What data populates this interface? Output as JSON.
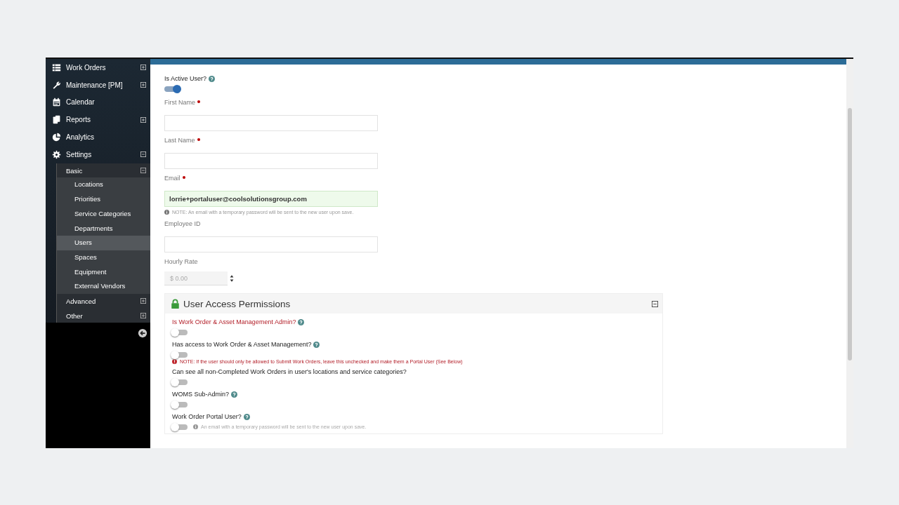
{
  "sidebar": {
    "items": [
      {
        "label": "Work Orders",
        "expandable": true,
        "expanded": false
      },
      {
        "label": "Maintenance [PM]",
        "expandable": true,
        "expanded": false
      },
      {
        "label": "Calendar",
        "expandable": false
      },
      {
        "label": "Reports",
        "expandable": true,
        "expanded": false
      },
      {
        "label": "Analytics",
        "expandable": false
      },
      {
        "label": "Settings",
        "expandable": true,
        "expanded": true,
        "children": [
          {
            "label": "Basic",
            "expanded": true,
            "children": [
              {
                "label": "Locations",
                "selected": false
              },
              {
                "label": "Priorities",
                "selected": false
              },
              {
                "label": "Service Categories",
                "selected": false
              },
              {
                "label": "Departments",
                "selected": false
              },
              {
                "label": "Users",
                "selected": true
              },
              {
                "label": "Spaces",
                "selected": false
              },
              {
                "label": "Equipment",
                "selected": false
              },
              {
                "label": "External Vendors",
                "selected": false
              }
            ]
          },
          {
            "label": "Advanced",
            "expanded": false
          },
          {
            "label": "Other",
            "expanded": false
          }
        ]
      }
    ]
  },
  "form": {
    "fields": [
      {
        "kind": "toggle",
        "label": "Is Active User?",
        "help": true,
        "on": true
      },
      {
        "kind": "text",
        "label": "First Name",
        "required": true
      },
      {
        "kind": "text",
        "label": "Last Name",
        "required": true
      },
      {
        "kind": "text",
        "label": "Email",
        "required": true,
        "value": "lorrie+portaluser@coolsolutionsgroup.com",
        "valid": true,
        "note": "NOTE: An email with a temporary password will be sent to the new user upon save."
      },
      {
        "kind": "text",
        "label": "Employee ID",
        "required": false
      },
      {
        "kind": "number",
        "label": "Hourly Rate",
        "required": false,
        "placeholder": "$ 0.00"
      }
    ]
  },
  "permissions": {
    "title": "User Access Permissions",
    "expanded": true,
    "items": [
      {
        "label": "Is Work Order & Asset Management Admin?",
        "warning": true,
        "help": true,
        "on": false
      },
      {
        "label": "Has access to Work Order & Asset Management?",
        "warning": false,
        "help": true,
        "on": false,
        "note": {
          "kind": "error",
          "text": "NOTE: If the user should only be allowed to Submit Work Orders, leave this unchecked and make them a Portal User (See Below)"
        }
      },
      {
        "label": "Can see all non-Completed Work Orders in user's locations and service categories?",
        "warning": false,
        "help": false,
        "on": false
      },
      {
        "label": "WOMS Sub-Admin?",
        "warning": false,
        "help": true,
        "on": false
      },
      {
        "label": "Work Order Portal User?",
        "warning": false,
        "help": true,
        "on": false,
        "note": {
          "kind": "info",
          "text": "An email with a temporary password will be sent to the new user upon save."
        }
      }
    ]
  }
}
